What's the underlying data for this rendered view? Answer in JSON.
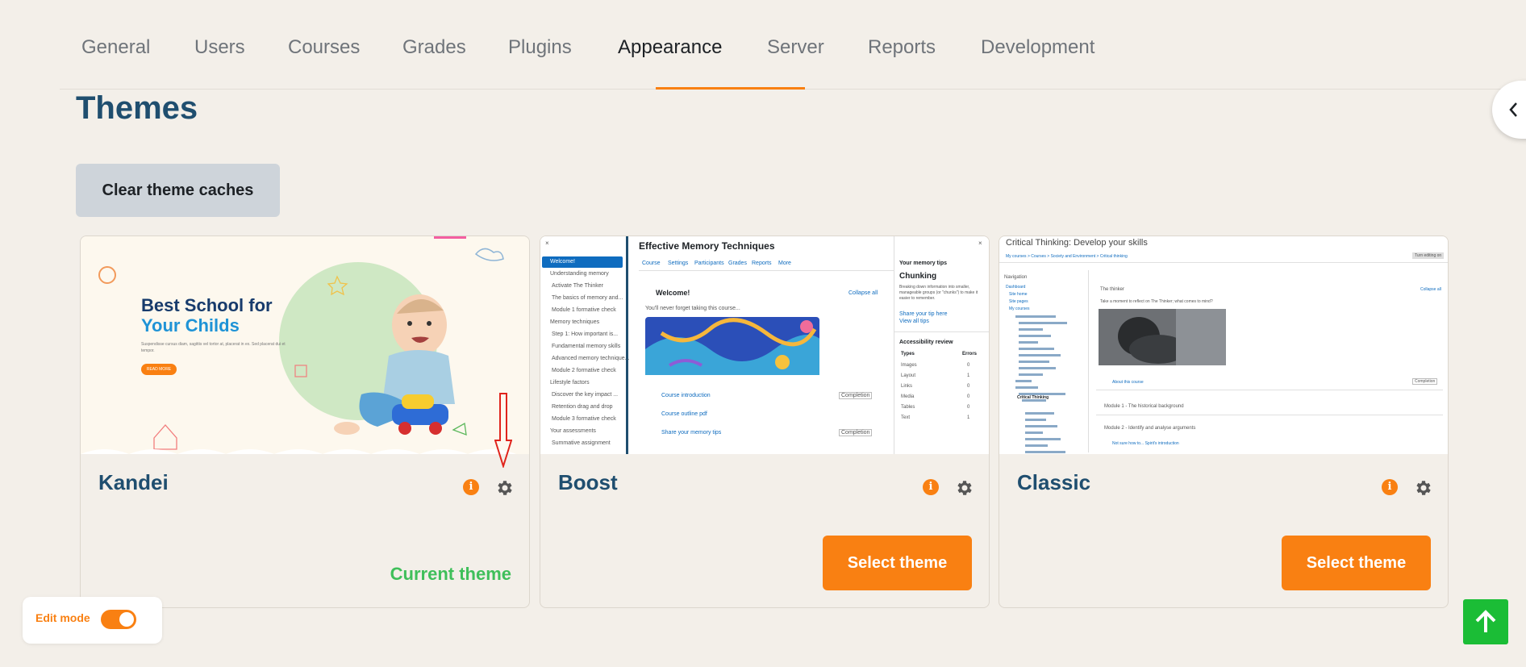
{
  "nav": {
    "items": [
      "General",
      "Users",
      "Courses",
      "Grades",
      "Plugins",
      "Appearance",
      "Server",
      "Reports",
      "Development"
    ],
    "active": "Appearance"
  },
  "page": {
    "title": "Themes",
    "clear_button": "Clear theme caches"
  },
  "themes": [
    {
      "name": "Kandei",
      "status": "Current theme"
    },
    {
      "name": "Boost",
      "action": "Select theme"
    },
    {
      "name": "Classic",
      "action": "Select theme"
    }
  ],
  "info_icon": "i",
  "kandei_preview": {
    "heading_line1": "Best School for",
    "heading_line2": "Your Childs",
    "body": "Suspendisse cursus diam, sagittis vel tortor at, placerat in ex. Sed placerat dui et tempor.",
    "button": "READ MORE"
  },
  "boost_preview": {
    "course_title": "Effective Memory Techniques",
    "tabs": [
      "Course",
      "Settings",
      "Participants",
      "Grades",
      "Reports",
      "More"
    ],
    "nav": [
      "Welcome!",
      "Understanding memory",
      "Activate The Thinker",
      "The basics of memory and...",
      "Module 1 formative check",
      "Memory techniques",
      "Step 1: How important is...",
      "Fundamental memory skills",
      "Advanced memory technique...",
      "Module 2 formative check",
      "Lifestyle factors",
      "Discover the key impact ...",
      "Retention drag and drop",
      "Module 3 formative check",
      "Your assessments",
      "Summative assignment"
    ],
    "welcome": "Welcome!",
    "collapse": "Collapse all",
    "welcome_sub": "You'll never forget taking this course...",
    "links": [
      "Course introduction",
      "Course outline pdf",
      "Share your memory tips"
    ],
    "completion": "Completion",
    "side_title": "Your memory tips",
    "side_heading": "Chunking",
    "side_body": "Breaking down information into smaller, manageable groups (or \"chunks\") to make it easier to remember.",
    "side_links": [
      "Share your tip here",
      "View all tips"
    ],
    "acc_title": "Accessibility review",
    "acc_cols": [
      "Types",
      "Errors"
    ],
    "acc_rows": [
      [
        "Images",
        "0"
      ],
      [
        "Layout",
        "1"
      ],
      [
        "Links",
        "0"
      ],
      [
        "Media",
        "0"
      ],
      [
        "Tables",
        "0"
      ],
      [
        "Text",
        "1"
      ]
    ]
  },
  "classic_preview": {
    "title": "Critical Thinking: Develop your skills",
    "breadcrumb": "My courses > Courses > Society and Environment > Critical thinking",
    "turn_editing": "Turn editing on",
    "navigation": "Navigation",
    "tree": [
      "Dashboard",
      "Site home",
      "Site pages",
      "My courses",
      "Critical Thinking"
    ],
    "section": "The thinker",
    "collapse": "Collapse all",
    "caption": "Take a moment to reflect on The Thinker; what comes to mind?",
    "modules": [
      "About this course",
      "Module 1 - The historical background",
      "Module 2 - Identify and analyse arguments",
      "Not sure how to... Spirit's introduction"
    ],
    "completion": "Completion"
  },
  "edit_mode": {
    "label": "Edit mode",
    "on": true
  },
  "colors": {
    "accent": "#f98012",
    "title": "#1f4e6f",
    "current": "#3fbf5a",
    "back_to_top": "#1bbd36",
    "annotation_arrow": "#e0241c"
  },
  "icons": [
    "chevron-left-icon",
    "info-icon",
    "gear-icon",
    "arrow-up-icon",
    "red-annotation-arrow-icon"
  ]
}
